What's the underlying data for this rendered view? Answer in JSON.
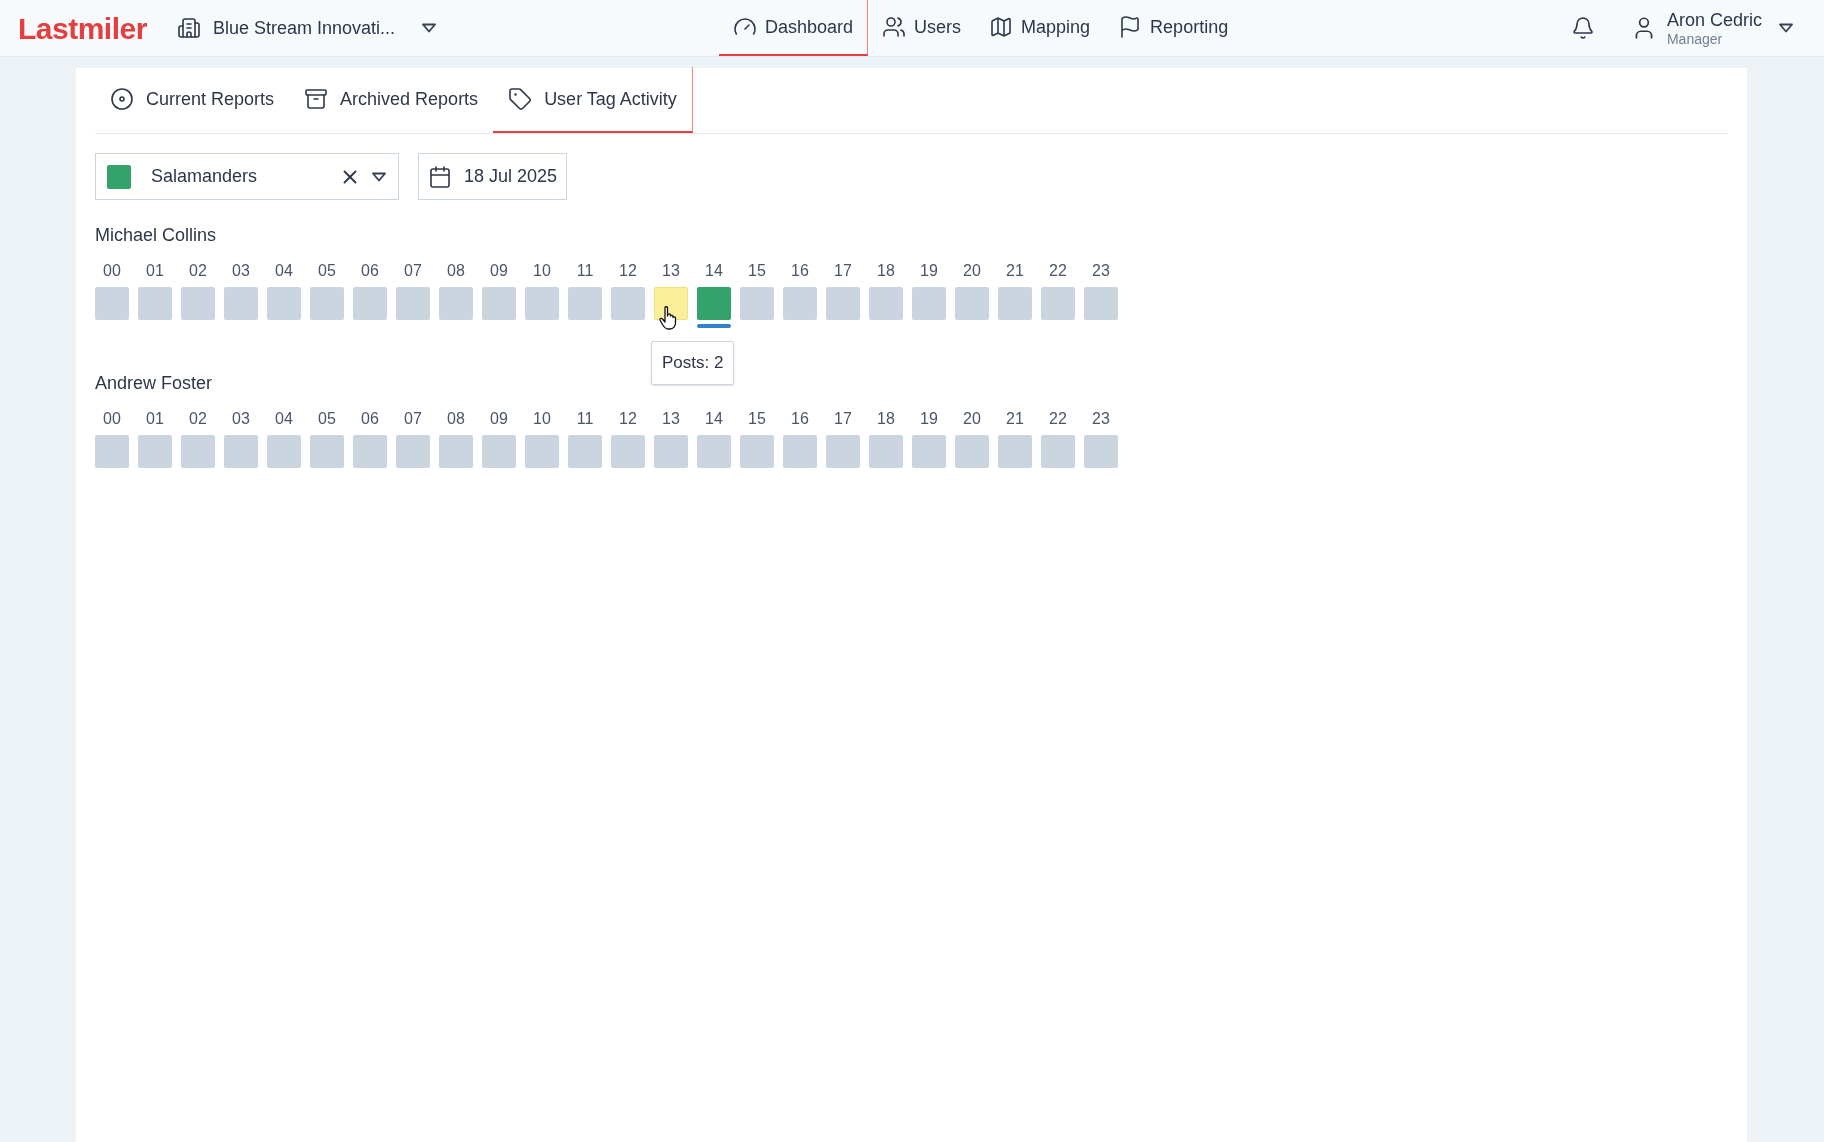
{
  "header": {
    "logo": "Lastmiler",
    "organization": "Blue Stream Innovati...",
    "nav": [
      {
        "label": "Dashboard",
        "selected": true
      },
      {
        "label": "Users",
        "selected": false
      },
      {
        "label": "Mapping",
        "selected": false
      },
      {
        "label": "Reporting",
        "selected": false
      }
    ],
    "user": {
      "name": "Aron Cedric",
      "role": "Manager"
    }
  },
  "tabs": [
    {
      "label": "Current Reports",
      "selected": false
    },
    {
      "label": "Archived Reports",
      "selected": false
    },
    {
      "label": "User Tag Activity",
      "selected": true
    }
  ],
  "filters": {
    "tag": {
      "label": "Salamanders",
      "color": "#34a36b"
    },
    "date": "18 Jul 2025"
  },
  "users": [
    {
      "name": "Michael Collins",
      "hours": [
        {
          "label": "00",
          "kind": "empty",
          "marked": false
        },
        {
          "label": "01",
          "kind": "empty",
          "marked": false
        },
        {
          "label": "02",
          "kind": "empty",
          "marked": false
        },
        {
          "label": "03",
          "kind": "empty",
          "marked": false
        },
        {
          "label": "04",
          "kind": "empty",
          "marked": false
        },
        {
          "label": "05",
          "kind": "empty",
          "marked": false
        },
        {
          "label": "06",
          "kind": "empty",
          "marked": false
        },
        {
          "label": "07",
          "kind": "empty",
          "marked": false
        },
        {
          "label": "08",
          "kind": "empty",
          "marked": false
        },
        {
          "label": "09",
          "kind": "empty",
          "marked": false
        },
        {
          "label": "10",
          "kind": "empty",
          "marked": false
        },
        {
          "label": "11",
          "kind": "empty",
          "marked": false
        },
        {
          "label": "12",
          "kind": "empty",
          "marked": false
        },
        {
          "label": "13",
          "kind": "hovered",
          "marked": false,
          "tooltip": "Posts: 2"
        },
        {
          "label": "14",
          "kind": "tagged",
          "marked": true
        },
        {
          "label": "15",
          "kind": "empty",
          "marked": false
        },
        {
          "label": "16",
          "kind": "empty",
          "marked": false
        },
        {
          "label": "17",
          "kind": "empty",
          "marked": false
        },
        {
          "label": "18",
          "kind": "empty",
          "marked": false
        },
        {
          "label": "19",
          "kind": "empty",
          "marked": false
        },
        {
          "label": "20",
          "kind": "empty",
          "marked": false
        },
        {
          "label": "21",
          "kind": "empty",
          "marked": false
        },
        {
          "label": "22",
          "kind": "empty",
          "marked": false
        },
        {
          "label": "23",
          "kind": "empty",
          "marked": false
        }
      ]
    },
    {
      "name": "Andrew Foster",
      "hours": [
        {
          "label": "00",
          "kind": "empty",
          "marked": false
        },
        {
          "label": "01",
          "kind": "empty",
          "marked": false
        },
        {
          "label": "02",
          "kind": "empty",
          "marked": false
        },
        {
          "label": "03",
          "kind": "empty",
          "marked": false
        },
        {
          "label": "04",
          "kind": "empty",
          "marked": false
        },
        {
          "label": "05",
          "kind": "empty",
          "marked": false
        },
        {
          "label": "06",
          "kind": "empty",
          "marked": false
        },
        {
          "label": "07",
          "kind": "empty",
          "marked": false
        },
        {
          "label": "08",
          "kind": "empty",
          "marked": false
        },
        {
          "label": "09",
          "kind": "empty",
          "marked": false
        },
        {
          "label": "10",
          "kind": "empty",
          "marked": false
        },
        {
          "label": "11",
          "kind": "empty",
          "marked": false
        },
        {
          "label": "12",
          "kind": "empty",
          "marked": false
        },
        {
          "label": "13",
          "kind": "empty",
          "marked": false
        },
        {
          "label": "14",
          "kind": "empty",
          "marked": false
        },
        {
          "label": "15",
          "kind": "empty",
          "marked": false
        },
        {
          "label": "16",
          "kind": "empty",
          "marked": false
        },
        {
          "label": "17",
          "kind": "empty",
          "marked": false
        },
        {
          "label": "18",
          "kind": "empty",
          "marked": false
        },
        {
          "label": "19",
          "kind": "empty",
          "marked": false
        },
        {
          "label": "20",
          "kind": "empty",
          "marked": false
        },
        {
          "label": "21",
          "kind": "empty",
          "marked": false
        },
        {
          "label": "22",
          "kind": "empty",
          "marked": false
        },
        {
          "label": "23",
          "kind": "empty",
          "marked": false
        }
      ]
    }
  ]
}
